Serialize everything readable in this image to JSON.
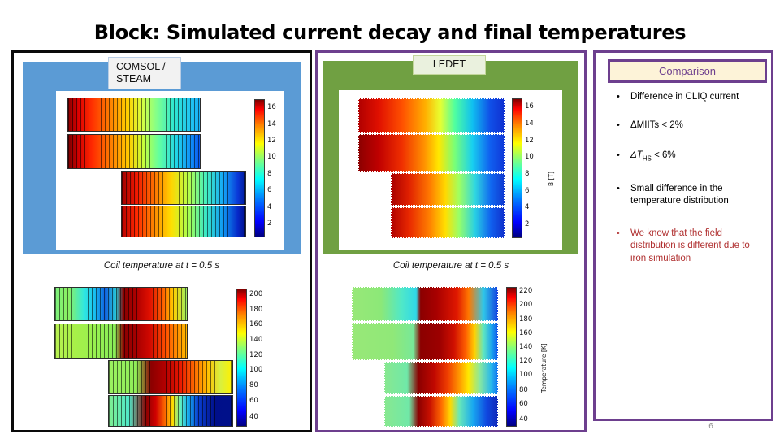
{
  "slide": {
    "title": "Block: Simulated current decay and final temperatures",
    "page_number": "6"
  },
  "panels": {
    "comsol": {
      "tab_label": "COMSOL / STEAM",
      "tab_line1": "COMSOL /",
      "tab_line2": "STEAM",
      "border_color": "#0a0a0a",
      "frame_color": "#5b9bd5",
      "caption": "Coil temperature at t = 0.5 s"
    },
    "ledet": {
      "tab_label": "LEDET",
      "border_color": "#6d3f8e",
      "frame_color": "#70a042",
      "caption": "Coil temperature at t = 0.5 s"
    },
    "comparison": {
      "header_label": "Comparison",
      "header_bg": "#fdf3d8",
      "header_text_color": "#6d3f8e",
      "border_color": "#6d3f8e",
      "bullets": [
        {
          "text": "Difference in CLIQ current",
          "color": "#000000"
        },
        {
          "text": "ΔMIITs  < 2%",
          "color": "#000000"
        },
        {
          "text": "ΔTHS < 6%",
          "color": "#000000",
          "rich": true
        },
        {
          "text": "Small difference in the temperature distribution",
          "color": "#000000"
        },
        {
          "text": "We know that the field distribution is different due to iron simulation",
          "color": "#b03030"
        }
      ]
    }
  },
  "chart_data": [
    {
      "id": "comsol-field",
      "type": "heatmap",
      "title": "COMSOL / STEAM magnetic field map",
      "quantity": "B",
      "unit": "T",
      "colorbar_ticks": [
        2,
        4,
        6,
        8,
        10,
        12,
        14,
        16
      ],
      "colorbar_label": "",
      "vmin": 1,
      "vmax": 17,
      "gradient_direction": "left-to-right: high to low",
      "geometry": "T-shaped coil block, 4 horizontal bands (2 wide upper, 2 narrow lower-right)",
      "mesh": "vertical strand lines"
    },
    {
      "id": "ledet-field",
      "type": "heatmap",
      "title": "LEDET magnetic field map",
      "quantity": "B",
      "unit": "T",
      "colorbar_ticks": [
        2,
        4,
        6,
        8,
        10,
        12,
        14,
        16
      ],
      "colorbar_label": "B [T]",
      "vmin": 1,
      "vmax": 17,
      "gradient_direction": "left-to-right: high to low",
      "geometry": "T-shaped coil block, 4 horizontal bands",
      "mesh": "dotted strand markers"
    },
    {
      "id": "comsol-temperature",
      "type": "heatmap",
      "title": "COMSOL / STEAM coil temperature at t = 0.5 s",
      "quantity": "Temperature",
      "unit": "K",
      "colorbar_ticks": [
        40,
        60,
        80,
        100,
        120,
        140,
        160,
        180,
        200
      ],
      "colorbar_label": "",
      "vmin": 30,
      "vmax": 210,
      "geometry": "T-shaped coil block, 4 horizontal bands",
      "mesh": "vertical strand lines"
    },
    {
      "id": "ledet-temperature",
      "type": "heatmap",
      "title": "LEDET coil temperature at t = 0.5 s",
      "quantity": "Temperature",
      "unit": "K",
      "colorbar_ticks": [
        40,
        60,
        80,
        100,
        120,
        140,
        160,
        180,
        200,
        220
      ],
      "colorbar_label": "Temperature [K]",
      "vmin": 30,
      "vmax": 230,
      "geometry": "T-shaped coil block, 4 horizontal bands",
      "mesh": "dotted strand markers"
    }
  ]
}
